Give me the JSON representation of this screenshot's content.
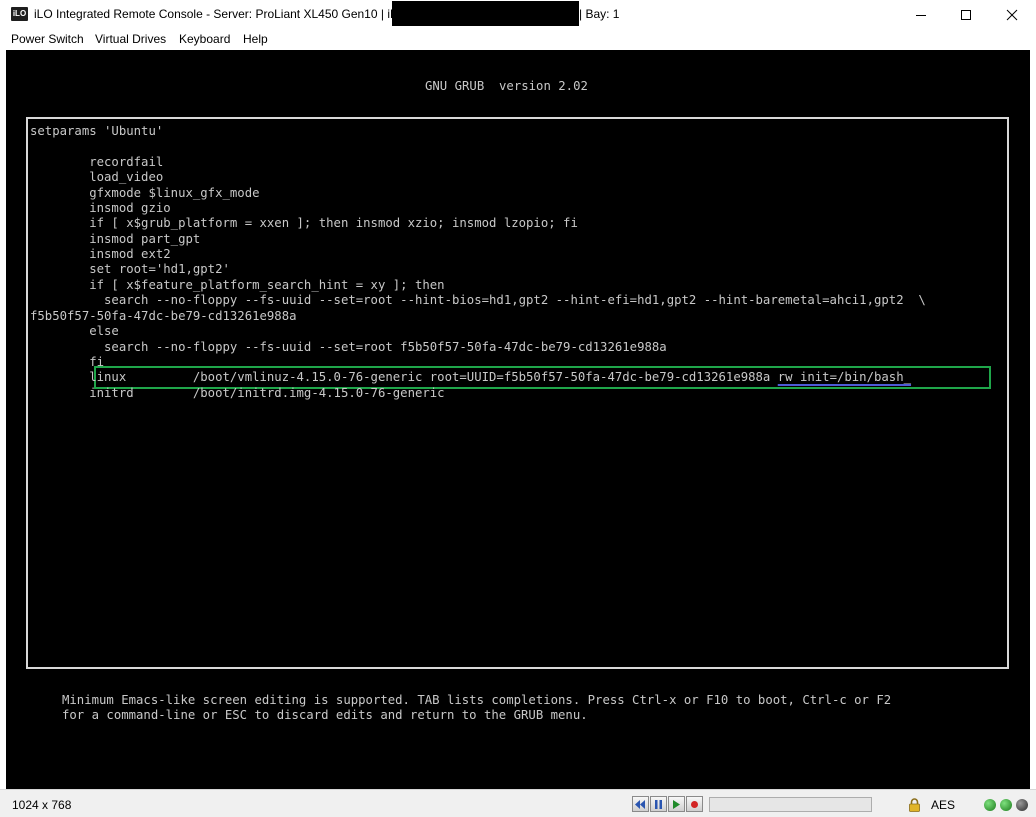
{
  "window": {
    "title": "iLO Integrated Remote Console - Server: ProLiant XL450 Gen10 | iLO:",
    "title_suffix": "| Bay: 1",
    "app_icon_text": "iLO"
  },
  "menu": {
    "items": [
      "Power Switch",
      "Virtual Drives",
      "Keyboard",
      "Help"
    ]
  },
  "console": {
    "header": "GNU GRUB  version 2.02",
    "lines": [
      "setparams 'Ubuntu'",
      "",
      "        recordfail",
      "        load_video",
      "        gfxmode $linux_gfx_mode",
      "        insmod gzio",
      "        if [ x$grub_platform = xxen ]; then insmod xzio; insmod lzopio; fi",
      "        insmod part_gpt",
      "        insmod ext2",
      "        set root='hd1,gpt2'",
      "        if [ x$feature_platform_search_hint = xy ]; then",
      "          search --no-floppy --fs-uuid --set=root --hint-bios=hd1,gpt2 --hint-efi=hd1,gpt2 --hint-baremetal=ahci1,gpt2  \\",
      "f5b50f57-50fa-47dc-be79-cd13261e988a",
      "        else",
      "          search --no-floppy --fs-uuid --set=root f5b50f57-50fa-47dc-be79-cd13261e988a",
      "        fi"
    ],
    "linux_line_prefix": "        linux         /boot/vmlinuz-4.15.0-76-generic root=UUID=f5b50f57-50fa-47dc-be79-cd13261e988a ",
    "linux_line_added": "rw init=/bin/bash_",
    "initrd_line": "        initrd        /boot/initrd.img-4.15.0-76-generic",
    "help_line1": "Minimum Emacs-like screen editing is supported. TAB lists completions. Press Ctrl-x or F10 to boot, Ctrl-c or F2",
    "help_line2": "for a command-line or ESC to discard edits and return to the GRUB menu."
  },
  "statusbar": {
    "resolution": "1024 x 768",
    "encryption": "AES",
    "media_buttons": [
      "rewind-icon",
      "pause-icon",
      "play-icon",
      "record-icon"
    ]
  },
  "colors": {
    "highlight_box": "#1fa64a",
    "added_text_underline": "#4e5bd6",
    "console_text": "#c8c8c8",
    "console_bg": "#000000"
  }
}
